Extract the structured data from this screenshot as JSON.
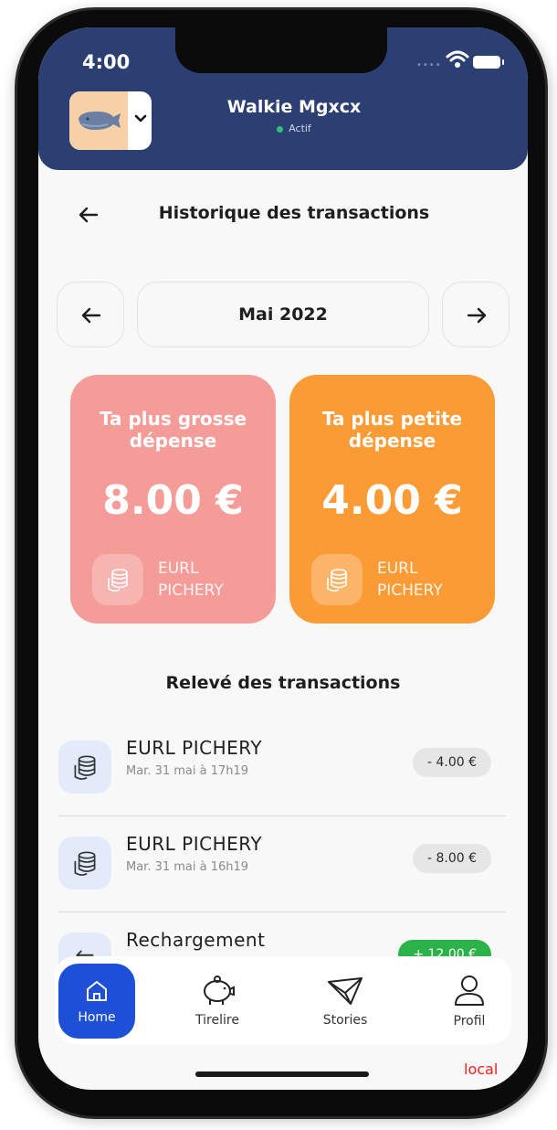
{
  "status_bar": {
    "time": "4:00"
  },
  "header": {
    "user_name": "Walkie Mgxcx",
    "user_status": "Actif"
  },
  "page": {
    "title": "Historique des transactions"
  },
  "month_selector": {
    "label": "Mai 2022"
  },
  "cards": {
    "biggest": {
      "title": "Ta plus grosse dépense",
      "amount": "8.00 €",
      "merchant": "EURL PICHERY",
      "color": "#f59c98"
    },
    "smallest": {
      "title": "Ta plus petite dépense",
      "amount": "4.00 €",
      "merchant": "EURL PICHERY",
      "color": "#fb9b36"
    }
  },
  "statement": {
    "title": "Relevé des transactions",
    "items": [
      {
        "name": "EURL PICHERY",
        "date": "Mar. 31 mai à 17h19",
        "amount": "- 4.00 €"
      },
      {
        "name": "EURL PICHERY",
        "date": "Mar. 31 mai à 16h19",
        "amount": "- 8.00 €"
      },
      {
        "name": "Rechargement",
        "date": "",
        "amount": "+ 12.00 €"
      }
    ]
  },
  "bottom_nav": {
    "items": [
      {
        "label": "Home",
        "icon": "home-icon",
        "active": true
      },
      {
        "label": "Tirelire",
        "icon": "piggy-bank-icon",
        "active": false
      },
      {
        "label": "Stories",
        "icon": "paper-plane-icon",
        "active": false
      },
      {
        "label": "Profil",
        "icon": "user-icon",
        "active": false
      }
    ]
  },
  "env_tag": "local",
  "colors": {
    "header": "#2b3f73",
    "accent": "#1d50d6",
    "positive": "#2bb34a"
  }
}
